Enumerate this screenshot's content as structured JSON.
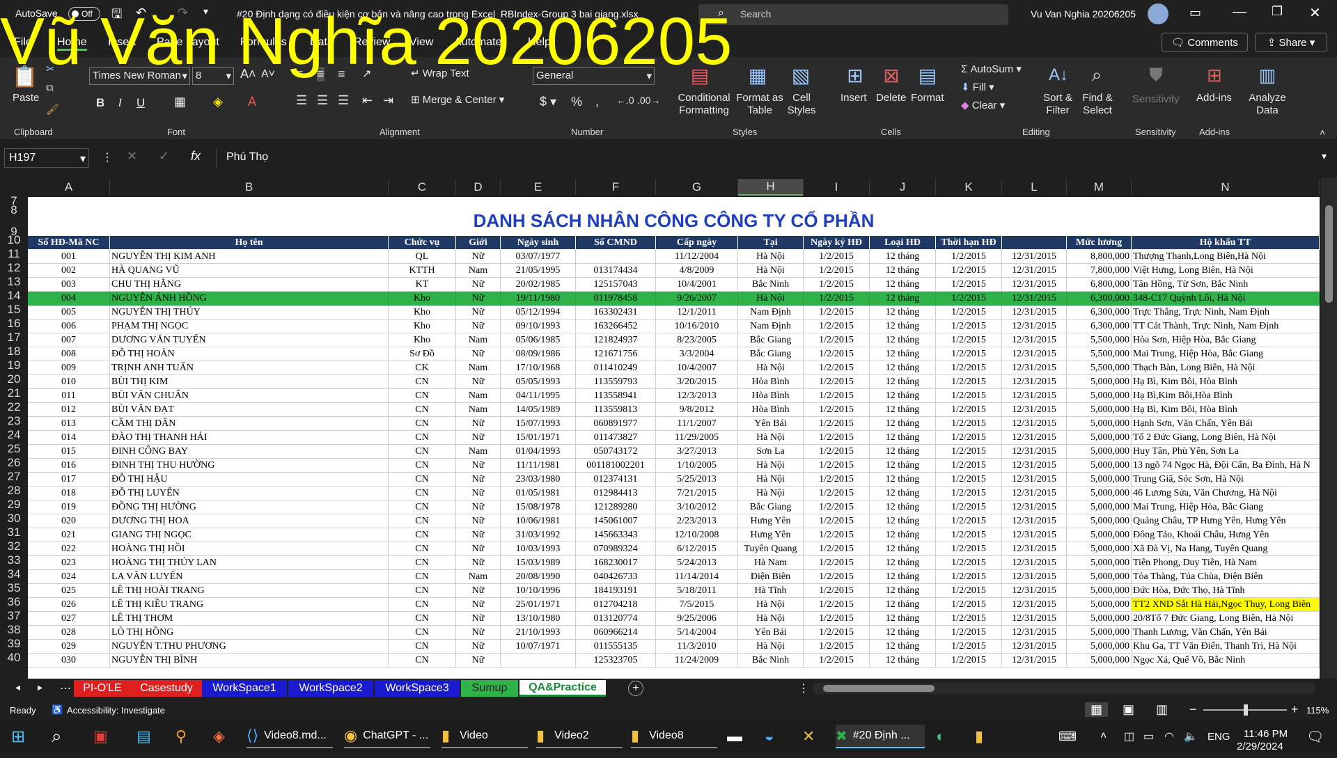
{
  "watermark": "Vũ Văn Nghĩa 20206205",
  "titlebar": {
    "autosave_label": "AutoSave",
    "autosave_state": "Off",
    "file_title": "#20 Định dạng có điều kiện cơ bản và nâng cao trong Excel_RBIndex-Group 3 bai giang.xlsx",
    "search_placeholder": "Search",
    "user_name": "Vu Van Nghia 20206205"
  },
  "menu": {
    "items": [
      "File",
      "Home",
      "Insert",
      "Page Layout",
      "Formulas",
      "Data",
      "Review",
      "View",
      "Automate",
      "Help"
    ],
    "comments": "Comments",
    "share": "Share"
  },
  "ribbon": {
    "paste": "Paste",
    "clipboard": "Clipboard",
    "font_name": "Times New Roman",
    "font_size": "8",
    "font": "Font",
    "wrap_text": "Wrap Text",
    "merge_center": "Merge & Center",
    "alignment": "Alignment",
    "number_format": "General",
    "number": "Number",
    "conditional_formatting": "Conditional Formatting",
    "format_as_table": "Format as Table",
    "cell_styles": "Cell Styles",
    "styles": "Styles",
    "insert": "Insert",
    "delete": "Delete",
    "format": "Format",
    "cells": "Cells",
    "autosum": "AutoSum",
    "fill": "Fill",
    "clear": "Clear",
    "sort_filter": "Sort & Filter",
    "find_select": "Find & Select",
    "editing": "Editing",
    "sensitivity": "Sensitivity",
    "addins": "Add-ins",
    "analyze_data": "Analyze Data",
    "addins_group": "Add-ins",
    "sensitivity_group": "Sensitivity"
  },
  "formula": {
    "name_box": "H197",
    "fx": "fx",
    "value": "Phú Thọ"
  },
  "columns": [
    "A",
    "B",
    "C",
    "D",
    "E",
    "F",
    "G",
    "H",
    "I",
    "J",
    "K",
    "L",
    "M",
    "N"
  ],
  "sheet": {
    "title": "DANH SÁCH NHÂN CÔNG CÔNG TY CỔ PHẦN",
    "headers": [
      "Số HĐ-Mã NC",
      "Họ tên",
      "Chức vụ",
      "Giới",
      "Ngày sinh",
      "Số CMND",
      "Cấp ngày",
      "Tại",
      "Ngày ký HĐ",
      "Loại HĐ",
      "Thời hạn HĐ",
      "",
      "Mức lương",
      "Hộ khẩu TT"
    ],
    "rows": [
      [
        "001",
        "NGUYỄN THỊ KIM ANH",
        "QL",
        "Nữ",
        "03/07/1977",
        "",
        "11/12/2004",
        "Hà Nội",
        "1/2/2015",
        "12 tháng",
        "1/2/2015",
        "12/31/2015",
        "8,800,000",
        "Thượng Thanh,Long Biên,Hà Nội"
      ],
      [
        "002",
        "HÀ QUANG VŨ",
        "KTTH",
        "Nam",
        "21/05/1995",
        "013174434",
        "4/8/2009",
        "Hà Nội",
        "1/2/2015",
        "12 tháng",
        "1/2/2015",
        "12/31/2015",
        "7,800,000",
        "Việt Hưng, Long Biên, Hà Nội"
      ],
      [
        "003",
        "CHU THỊ HẰNG",
        "KT",
        "Nữ",
        "20/02/1985",
        "125157043",
        "10/4/2001",
        "Bắc Ninh",
        "1/2/2015",
        "12 tháng",
        "1/2/2015",
        "12/31/2015",
        "6,800,000",
        "Tân Hồng, Từ Sơn, Bắc Ninh"
      ],
      [
        "004",
        "NGUYỄN ÁNH HỒNG",
        "Kho",
        "Nữ",
        "19/11/1980",
        "011978458",
        "9/26/2007",
        "Hà Nội",
        "1/2/2015",
        "12 tháng",
        "1/2/2015",
        "12/31/2015",
        "6,300,000",
        "348-C17 Quỳnh Lôi, Hà Nội"
      ],
      [
        "005",
        "NGUYỄN THỊ THÚY",
        "Kho",
        "Nữ",
        "05/12/1994",
        "163302431",
        "12/1/2011",
        "Nam Định",
        "1/2/2015",
        "12 tháng",
        "1/2/2015",
        "12/31/2015",
        "6,300,000",
        "Trực Thắng, Trực Ninh, Nam Định"
      ],
      [
        "006",
        "PHẠM THỊ NGỌC",
        "Kho",
        "Nữ",
        "09/10/1993",
        "163266452",
        "10/16/2010",
        "Nam Định",
        "1/2/2015",
        "12 tháng",
        "1/2/2015",
        "12/31/2015",
        "6,300,000",
        "TT Cát Thành, Trực Ninh, Nam Định"
      ],
      [
        "007",
        "DƯƠNG VĂN TUYẾN",
        "Kho",
        "Nam",
        "05/06/1985",
        "121824937",
        "8/23/2005",
        "Bắc Giang",
        "1/2/2015",
        "12 tháng",
        "1/2/2015",
        "12/31/2015",
        "5,500,000",
        "Hòa Sơn, Hiệp Hòa, Bắc Giang"
      ],
      [
        "008",
        "ĐỖ THỊ HOÀN",
        "Sơ Đồ",
        "Nữ",
        "08/09/1986",
        "121671756",
        "3/3/2004",
        "Bắc Giang",
        "1/2/2015",
        "12 tháng",
        "1/2/2015",
        "12/31/2015",
        "5,500,000",
        "Mai Trung, Hiệp Hòa, Bắc Giang"
      ],
      [
        "009",
        "TRỊNH ANH TUẤN",
        "CK",
        "Nam",
        "17/10/1968",
        "011410249",
        "10/4/2007",
        "Hà Nội",
        "1/2/2015",
        "12 tháng",
        "1/2/2015",
        "12/31/2015",
        "5,500,000",
        "Thạch Bàn, Long Biên, Hà Nội"
      ],
      [
        "010",
        "BÙI THỊ KIM",
        "CN",
        "Nữ",
        "05/05/1993",
        "113559793",
        "3/20/2015",
        "Hòa Bình",
        "1/2/2015",
        "12 tháng",
        "1/2/2015",
        "12/31/2015",
        "5,000,000",
        "Hạ Bì, Kim Bôi, Hòa Bình"
      ],
      [
        "011",
        "BÙI VĂN CHUẨN",
        "CN",
        "Nam",
        "04/11/1995",
        "113558941",
        "12/3/2013",
        "Hòa Bình",
        "1/2/2015",
        "12 tháng",
        "1/2/2015",
        "12/31/2015",
        "5,000,000",
        "Hạ Bì,Kim Bôi,Hòa Bình"
      ],
      [
        "012",
        "BÙI VĂN ĐẠT",
        "CN",
        "Nam",
        "14/05/1989",
        "113559813",
        "9/8/2012",
        "Hòa Bình",
        "1/2/2015",
        "12 tháng",
        "1/2/2015",
        "12/31/2015",
        "5,000,000",
        "Hạ Bì, Kim Bôi, Hòa Bình"
      ],
      [
        "013",
        "CẦM THỊ DÂN",
        "CN",
        "Nữ",
        "15/07/1993",
        "060891977",
        "11/1/2007",
        "Yên Bái",
        "1/2/2015",
        "12 tháng",
        "1/2/2015",
        "12/31/2015",
        "5,000,000",
        "Hạnh Sơn, Văn Chấn, Yên Bái"
      ],
      [
        "014",
        "ĐÀO THỊ THANH HẢI",
        "CN",
        "Nữ",
        "15/01/1971",
        "011473827",
        "11/29/2005",
        "Hà Nội",
        "1/2/2015",
        "12 tháng",
        "1/2/2015",
        "12/31/2015",
        "5,000,000",
        "Tổ 2 Đức Giang, Long Biên, Hà Nội"
      ],
      [
        "015",
        "ĐINH CÔNG BAY",
        "CN",
        "Nam",
        "01/04/1993",
        "050743172",
        "3/27/2013",
        "Sơn La",
        "1/2/2015",
        "12 tháng",
        "1/2/2015",
        "12/31/2015",
        "5,000,000",
        "Huy Tân, Phù Yên, Sơn La"
      ],
      [
        "016",
        "ĐINH THỊ THU HƯỜNG",
        "CN",
        "Nữ",
        "11/11/1981",
        "001181002201",
        "1/10/2005",
        "Hà Nội",
        "1/2/2015",
        "12 tháng",
        "1/2/2015",
        "12/31/2015",
        "5,000,000",
        "13 ngõ 74 Ngọc Hà, Đội Cấn, Ba Đình, Hà N"
      ],
      [
        "017",
        "ĐỖ THỊ HẬU",
        "CN",
        "Nữ",
        "23/03/1980",
        "012374131",
        "5/25/2013",
        "Hà Nội",
        "1/2/2015",
        "12 tháng",
        "1/2/2015",
        "12/31/2015",
        "5,000,000",
        "Trung Giã, Sóc Sơn, Hà Nội"
      ],
      [
        "018",
        "ĐỖ THỊ LUYẾN",
        "CN",
        "Nữ",
        "01/05/1981",
        "012984413",
        "7/21/2015",
        "Hà Nội",
        "1/2/2015",
        "12 tháng",
        "1/2/2015",
        "12/31/2015",
        "5,000,000",
        "46 Lương Sửa, Văn Chương, Hà Nội"
      ],
      [
        "019",
        "ĐỒNG THỊ HƯỜNG",
        "CN",
        "Nữ",
        "15/08/1978",
        "121289280",
        "3/10/2012",
        "Bắc Giang",
        "1/2/2015",
        "12 tháng",
        "1/2/2015",
        "12/31/2015",
        "5,000,000",
        "Mai Trung, Hiệp Hòa, Bắc Giang"
      ],
      [
        "020",
        "DƯƠNG THỊ HOA",
        "CN",
        "Nữ",
        "10/06/1981",
        "145061007",
        "2/23/2013",
        "Hưng Yên",
        "1/2/2015",
        "12 tháng",
        "1/2/2015",
        "12/31/2015",
        "5,000,000",
        "Quảng Châu, TP Hưng Yên, Hưng Yên"
      ],
      [
        "021",
        "GIANG THỊ NGỌC",
        "CN",
        "Nữ",
        "31/03/1992",
        "145663343",
        "12/10/2008",
        "Hưng Yên",
        "1/2/2015",
        "12 tháng",
        "1/2/2015",
        "12/31/2015",
        "5,000,000",
        "Đông Tảo, Khoái Châu, Hưng Yên"
      ],
      [
        "022",
        "HOÀNG THỊ HỒI",
        "CN",
        "Nữ",
        "10/03/1993",
        "070989324",
        "6/12/2015",
        "Tuyên Quang",
        "1/2/2015",
        "12 tháng",
        "1/2/2015",
        "12/31/2015",
        "5,000,000",
        "Xã Đà Vị, Na Hang, Tuyên Quang"
      ],
      [
        "023",
        "HOÀNG THỊ THÚY LAN",
        "CN",
        "Nữ",
        "15/03/1989",
        "168230017",
        "5/24/2013",
        "Hà Nam",
        "1/2/2015",
        "12 tháng",
        "1/2/2015",
        "12/31/2015",
        "5,000,000",
        "Tiên Phong, Duy Tiên, Hà Nam"
      ],
      [
        "024",
        "LA VĂN LUYẾN",
        "CN",
        "Nam",
        "20/08/1990",
        "040426733",
        "11/14/2014",
        "Điện Biên",
        "1/2/2015",
        "12 tháng",
        "1/2/2015",
        "12/31/2015",
        "5,000,000",
        "Tỏa Thàng, Tủa Chùa, Điện Biên"
      ],
      [
        "025",
        "LÊ THỊ HOÀI TRANG",
        "CN",
        "Nữ",
        "10/10/1996",
        "184193191",
        "5/18/2011",
        "Hà Tĩnh",
        "1/2/2015",
        "12 tháng",
        "1/2/2015",
        "12/31/2015",
        "5,000,000",
        "Đức Hòa, Đức Thọ, Hà Tĩnh"
      ],
      [
        "026",
        "LÊ THỊ KIỀU TRANG",
        "CN",
        "Nữ",
        "25/01/1971",
        "012704218",
        "7/5/2015",
        "Hà Nội",
        "1/2/2015",
        "12 tháng",
        "1/2/2015",
        "12/31/2015",
        "5,000,000",
        "TT2 XND Sắt Hà Hải,Ngọc Thụy, Long Biên"
      ],
      [
        "027",
        "LÊ THỊ THƠM",
        "CN",
        "Nữ",
        "13/10/1980",
        "013120774",
        "9/25/2006",
        "Hà Nội",
        "1/2/2015",
        "12 tháng",
        "1/2/2015",
        "12/31/2015",
        "5,000,000",
        "20/8Tổ 7 Đức Giang, Long Biên, Hà Nội"
      ],
      [
        "028",
        "LÒ THỊ HỒNG",
        "CN",
        "Nữ",
        "21/10/1993",
        "060966214",
        "5/14/2004",
        "Yên Bái",
        "1/2/2015",
        "12 tháng",
        "1/2/2015",
        "12/31/2015",
        "5,000,000",
        "Thanh Lương, Văn Chấn, Yên Bái"
      ],
      [
        "029",
        "NGUYỄN T.THU PHƯƠNG",
        "CN",
        "Nữ",
        "10/07/1971",
        "011555135",
        "11/3/2010",
        "Hà Nội",
        "1/2/2015",
        "12 tháng",
        "1/2/2015",
        "12/31/2015",
        "5,000,000",
        "Khu Ga, TT Văn Điển, Thanh Trì, Hà Nội"
      ],
      [
        "030",
        "NGUYỄN THỊ BÌNH",
        "CN",
        "Nữ",
        "",
        "125323705",
        "11/24/2009",
        "Bắc Ninh",
        "1/2/2015",
        "12 tháng",
        "1/2/2015",
        "12/31/2015",
        "5,000,000",
        "Ngọc Xá, Quế Võ, Bắc Ninh"
      ]
    ],
    "highlight_row_index": 3,
    "yellow_row_index": 25
  },
  "row_numbers": [
    "7",
    "8",
    "9",
    "10",
    "11",
    "12",
    "13",
    "14",
    "15",
    "16",
    "17",
    "18",
    "19",
    "20",
    "21",
    "22",
    "23",
    "24",
    "25",
    "26",
    "27",
    "28",
    "29",
    "30",
    "31",
    "32",
    "33",
    "34",
    "35",
    "36",
    "37",
    "38",
    "39",
    "40"
  ],
  "tabs": [
    "PI-O'LE",
    "Casestudy",
    "WorkSpace1",
    "WorkSpace2",
    "WorkSpace3",
    "Sumup",
    "QA&Practice"
  ],
  "status": {
    "ready": "Ready",
    "accessibility": "Accessibility: Investigate",
    "zoom": "115%"
  },
  "taskbar": {
    "apps": [
      "Video8.md...",
      "ChatGPT - ...",
      "Video",
      "Video2",
      "Video8",
      "#20 Định ..."
    ],
    "lang": "ENG",
    "time": "11:46 PM",
    "date": "2/29/2024"
  },
  "colors": {
    "highlight": "#2db34a",
    "yellow": "#ffff00",
    "header_blue": "#1f3864",
    "title_blue": "#1f3fbf",
    "watermark": "#ffff00"
  }
}
